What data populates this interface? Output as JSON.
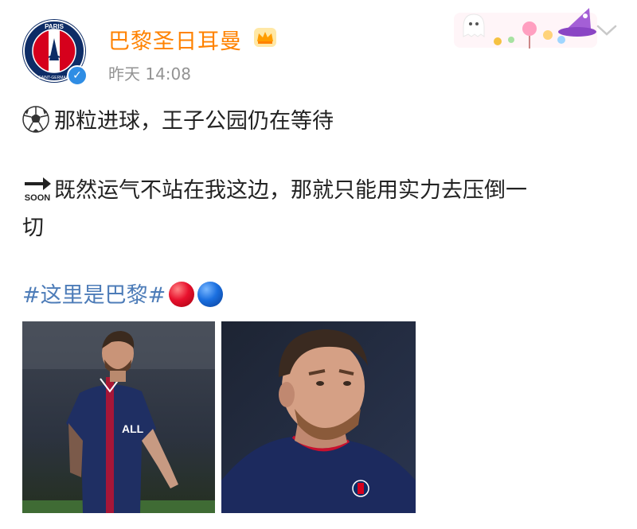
{
  "post": {
    "author": "巴黎圣日耳曼",
    "time": "昨天 14:08",
    "line1": "那粒进球，王子公园仍在等待",
    "line2": "既然运气不站在我这边，那就只能用实力去压倒一",
    "line3": "切",
    "hashtag": "#这里是巴黎#"
  },
  "avatar": {
    "text_top": "PARIS",
    "text_bottom": "SAINT-GERMAIN"
  },
  "icons": {
    "verified": "✓",
    "ball": "soccer-ball-icon",
    "soon": "SOON",
    "chevron": "chevron-down-icon"
  },
  "colors": {
    "author": "#ff8200",
    "hashtag": "#4d7cb8",
    "time": "#939393"
  }
}
